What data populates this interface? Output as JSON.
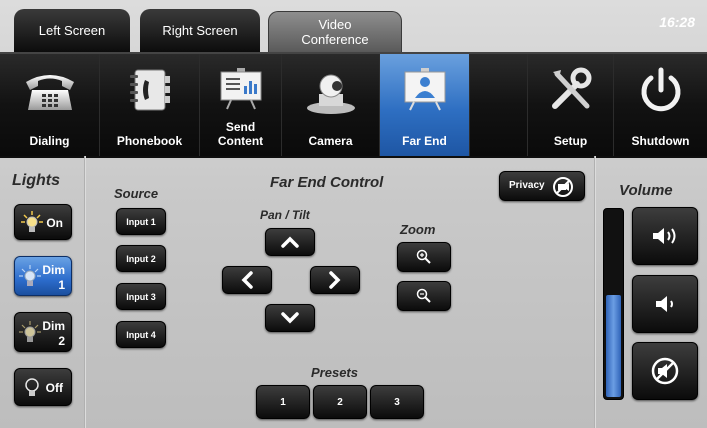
{
  "tabs": [
    {
      "label": "Left Screen"
    },
    {
      "label": "Right Screen"
    },
    {
      "label": "Video Conference",
      "line1": "Video",
      "line2": "Conference"
    }
  ],
  "clock": "16:28",
  "toolbar": {
    "items": [
      {
        "label": "Dialing",
        "icon": "phone-icon"
      },
      {
        "label": "Phonebook",
        "icon": "phonebook-icon"
      },
      {
        "label": "Send Content",
        "line1": "Send",
        "line2": "Content",
        "icon": "presentation-icon"
      },
      {
        "label": "Camera",
        "icon": "camera-icon"
      },
      {
        "label": "Far End",
        "icon": "far-end-icon",
        "active": true
      },
      {
        "label": "Setup",
        "icon": "tools-icon"
      },
      {
        "label": "Shutdown",
        "icon": "power-icon"
      }
    ]
  },
  "lights": {
    "title": "Lights",
    "buttons": [
      {
        "label": "On"
      },
      {
        "label": "Dim",
        "sub": "1",
        "active": true
      },
      {
        "label": "Dim",
        "sub": "2"
      },
      {
        "label": "Off"
      }
    ]
  },
  "source": {
    "title": "Source",
    "inputs": [
      "Input 1",
      "Input 2",
      "Input 3",
      "Input 4"
    ]
  },
  "far_end": {
    "title": "Far End Control",
    "pan_tilt_label": "Pan / Tilt",
    "zoom_label": "Zoom",
    "presets_label": "Presets",
    "presets": [
      "1",
      "2",
      "3"
    ],
    "privacy_label": "Privacy"
  },
  "volume": {
    "title": "Volume",
    "level": 0.55
  },
  "colors": {
    "accent_blue": "#2c6ccc",
    "toolbar_black": "#0e0e0e"
  }
}
